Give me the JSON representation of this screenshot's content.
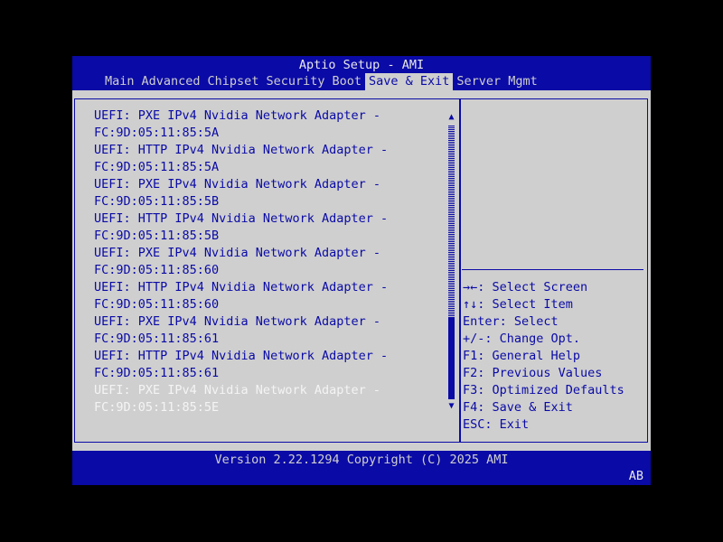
{
  "header": {
    "title": "Aptio Setup - AMI",
    "tabs": [
      {
        "label": "Main",
        "active": false
      },
      {
        "label": "Advanced",
        "active": false
      },
      {
        "label": "Chipset",
        "active": false
      },
      {
        "label": "Security",
        "active": false
      },
      {
        "label": "Boot",
        "active": false
      },
      {
        "label": "Save & Exit",
        "active": true
      },
      {
        "label": "Server Mgmt",
        "active": false
      }
    ]
  },
  "boot_override": {
    "items": [
      {
        "line1": "UEFI: PXE IPv4 Nvidia Network Adapter -",
        "line2": "FC:9D:05:11:85:5A",
        "selected": false
      },
      {
        "line1": "UEFI: HTTP IPv4 Nvidia Network Adapter -",
        "line2": "FC:9D:05:11:85:5A",
        "selected": false
      },
      {
        "line1": "UEFI: PXE IPv4 Nvidia Network Adapter -",
        "line2": "FC:9D:05:11:85:5B",
        "selected": false
      },
      {
        "line1": "UEFI: HTTP IPv4 Nvidia Network Adapter -",
        "line2": "FC:9D:05:11:85:5B",
        "selected": false
      },
      {
        "line1": "UEFI: PXE IPv4 Nvidia Network Adapter -",
        "line2": "FC:9D:05:11:85:60",
        "selected": false
      },
      {
        "line1": "UEFI: HTTP IPv4 Nvidia Network Adapter -",
        "line2": "FC:9D:05:11:85:60",
        "selected": false
      },
      {
        "line1": "UEFI: PXE IPv4 Nvidia Network Adapter -",
        "line2": "FC:9D:05:11:85:61",
        "selected": false
      },
      {
        "line1": "UEFI: HTTP IPv4 Nvidia Network Adapter -",
        "line2": "FC:9D:05:11:85:61",
        "selected": false
      },
      {
        "line1": "UEFI: PXE IPv4 Nvidia Network Adapter -",
        "line2": "FC:9D:05:11:85:5E",
        "selected": true
      }
    ],
    "scroll": {
      "up_glyph": "▲",
      "down_glyph": "▼",
      "thumb_start_fraction": 0.7,
      "thumb_end_fraction": 1.0
    }
  },
  "help": {
    "description": "",
    "keys": [
      "→←: Select Screen",
      "↑↓: Select Item",
      "Enter: Select",
      "+/-: Change Opt.",
      "F1: General Help",
      "F2: Previous Values",
      "F3: Optimized Defaults",
      "F4: Save & Exit",
      "ESC: Exit"
    ]
  },
  "footer": {
    "version": "Version 2.22.1294 Copyright (C) 2025 AMI",
    "badge": "AB"
  },
  "colors": {
    "bios_blue": "#0a0aa6",
    "panel_gray": "#cfcfcf",
    "highlight_white": "#f4f4f4",
    "background": "#000000"
  }
}
